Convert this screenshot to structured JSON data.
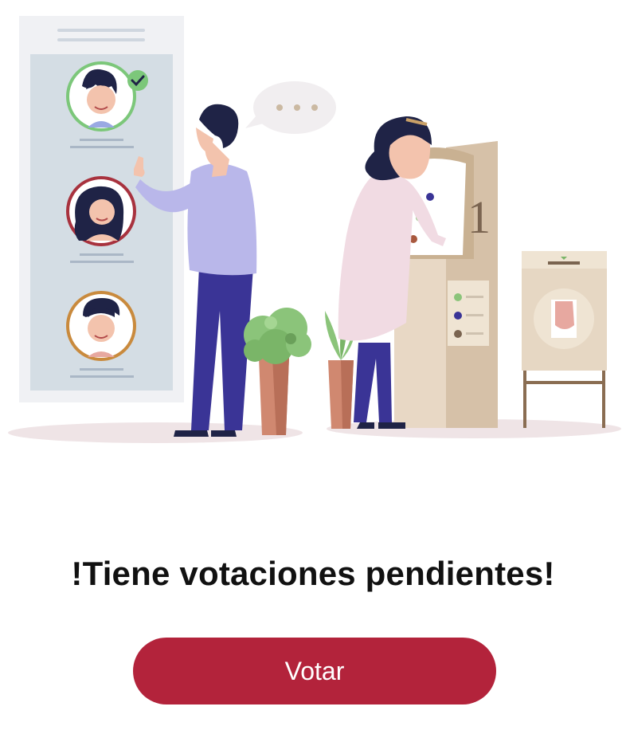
{
  "headline": "!Tiene votaciones pendientes!",
  "vote_button": {
    "label": "Votar"
  },
  "colors": {
    "accent": "#b3233b",
    "candidate_selected": "#7cc77a",
    "candidate_highlight": "#a8323e",
    "candidate_other": "#c98a3d"
  },
  "illustration": {
    "icons": [
      "candidate-list-panel",
      "voter-man",
      "speech-bubble",
      "voting-machine",
      "voter-woman",
      "ballot-box",
      "potted-plant"
    ]
  }
}
